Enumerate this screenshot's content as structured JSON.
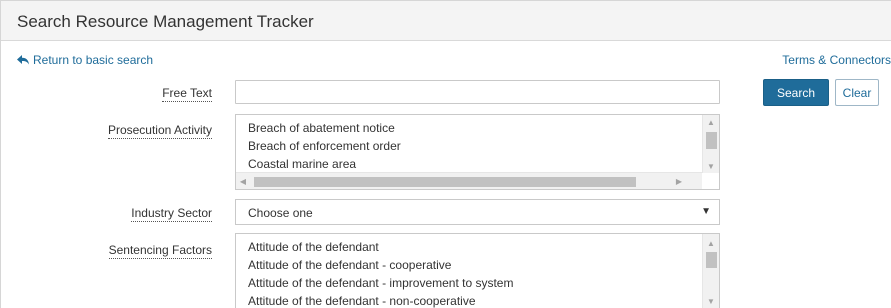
{
  "header": {
    "title": "Search Resource Management Tracker"
  },
  "nav": {
    "return_label": "Return to basic search",
    "terms_label": "Terms & Connectors"
  },
  "free_text": {
    "label": "Free Text",
    "value": "",
    "placeholder": ""
  },
  "buttons": {
    "search_label": "Search",
    "clear_label": "Clear"
  },
  "prosecution_activity": {
    "label": "Prosecution Activity",
    "options": [
      "Breach of abatement notice",
      "Breach of enforcement order",
      "Coastal marine area"
    ]
  },
  "industry_sector": {
    "label": "Industry Sector",
    "selected": "Choose one"
  },
  "sentencing_factors": {
    "label": "Sentencing Factors",
    "options": [
      "Attitude of the defendant",
      "Attitude of the defendant - cooperative",
      "Attitude of the defendant - improvement to system",
      "Attitude of the defendant - non-cooperative"
    ]
  },
  "colors": {
    "accent": "#1f6c9a",
    "header_bg": "#f4f4f4",
    "border": "#c9c9c9"
  }
}
